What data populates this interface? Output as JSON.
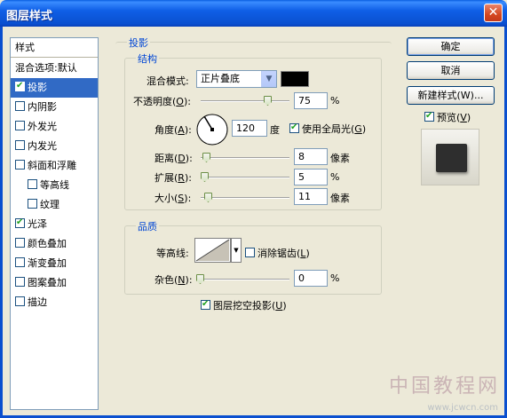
{
  "window": {
    "title": "图层样式",
    "close_glyph": "✕"
  },
  "style_list": {
    "header": "样式",
    "items": [
      {
        "label": "混合选项:默认",
        "checkbox": false,
        "checked": false,
        "selected": false,
        "indent": false
      },
      {
        "label": "投影",
        "checkbox": true,
        "checked": true,
        "selected": true,
        "indent": false
      },
      {
        "label": "内阴影",
        "checkbox": true,
        "checked": false,
        "selected": false,
        "indent": false
      },
      {
        "label": "外发光",
        "checkbox": true,
        "checked": false,
        "selected": false,
        "indent": false
      },
      {
        "label": "内发光",
        "checkbox": true,
        "checked": false,
        "selected": false,
        "indent": false
      },
      {
        "label": "斜面和浮雕",
        "checkbox": true,
        "checked": false,
        "selected": false,
        "indent": false
      },
      {
        "label": "等高线",
        "checkbox": true,
        "checked": false,
        "selected": false,
        "indent": true
      },
      {
        "label": "纹理",
        "checkbox": true,
        "checked": false,
        "selected": false,
        "indent": true
      },
      {
        "label": "光泽",
        "checkbox": true,
        "checked": true,
        "selected": false,
        "indent": false
      },
      {
        "label": "颜色叠加",
        "checkbox": true,
        "checked": false,
        "selected": false,
        "indent": false
      },
      {
        "label": "渐变叠加",
        "checkbox": true,
        "checked": false,
        "selected": false,
        "indent": false
      },
      {
        "label": "图案叠加",
        "checkbox": true,
        "checked": false,
        "selected": false,
        "indent": false
      },
      {
        "label": "描边",
        "checkbox": true,
        "checked": false,
        "selected": false,
        "indent": false
      }
    ]
  },
  "drop_shadow": {
    "title": "投影",
    "structure": {
      "title": "结构",
      "blend_mode_label": "混合模式:",
      "blend_mode_value": "正片叠底",
      "shadow_color": "#000000",
      "opacity_label_a": "不透明度(",
      "opacity_label_key": "O",
      "opacity_label_b": "):",
      "opacity_value": "75",
      "opacity_unit": "%",
      "angle_label_a": "角度(",
      "angle_label_key": "A",
      "angle_label_b": "):",
      "angle_value": "120",
      "angle_unit": "度",
      "global_light_label_a": "使用全局光(",
      "global_light_key": "G",
      "global_light_label_b": ")",
      "global_light_checked": true,
      "distance_label_a": "距离(",
      "distance_key": "D",
      "distance_label_b": "):",
      "distance_value": "8",
      "distance_unit": "像素",
      "spread_label_a": "扩展(",
      "spread_key": "R",
      "spread_label_b": "):",
      "spread_value": "5",
      "spread_unit": "%",
      "size_label_a": "大小(",
      "size_key": "S",
      "size_label_b": "):",
      "size_value": "11",
      "size_unit": "像素"
    },
    "quality": {
      "title": "品质",
      "contour_label": "等高线:",
      "antialias_label_a": "消除锯齿(",
      "antialias_key": "L",
      "antialias_label_b": ")",
      "antialias_checked": false,
      "noise_label_a": "杂色(",
      "noise_key": "N",
      "noise_label_b": "):",
      "noise_value": "0",
      "noise_unit": "%"
    },
    "knockout_label_a": "图层挖空投影(",
    "knockout_key": "U",
    "knockout_label_b": ")",
    "knockout_checked": true
  },
  "buttons": {
    "ok": "确定",
    "cancel": "取消",
    "new_style": "新建样式(W)...",
    "preview_label_a": "预览(",
    "preview_key": "V",
    "preview_label_b": ")",
    "preview_checked": true
  },
  "watermark": {
    "text": "中国教程网",
    "url": "www.jcwcn.com"
  }
}
